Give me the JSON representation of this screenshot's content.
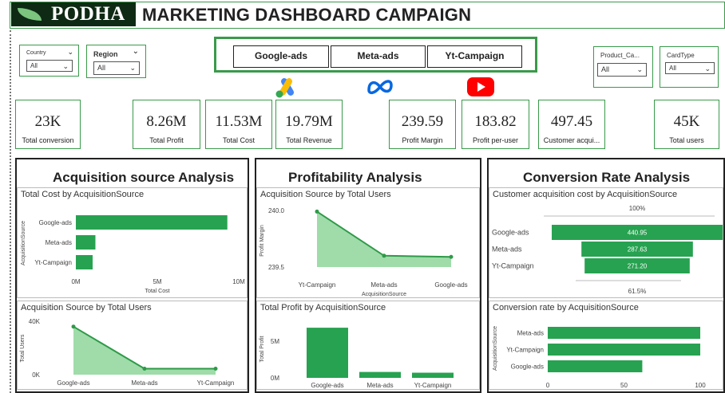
{
  "header": {
    "logo_text": "PODHA",
    "title": "MARKETING DASHBOARD CAMPAIGN"
  },
  "slicers": {
    "country": {
      "label": "Country",
      "value": "All"
    },
    "region": {
      "label": "Region",
      "value": "All"
    },
    "product_category": {
      "label": "Product_Ca...",
      "value": "All"
    },
    "card_type": {
      "label": "CardType",
      "value": "All"
    }
  },
  "source_buttons": [
    "Google-ads",
    "Meta-ads",
    "Yt-Campaign"
  ],
  "source_icons": [
    "google-ads-icon",
    "meta-icon",
    "youtube-icon"
  ],
  "kpis": [
    {
      "value": "23K",
      "label": "Total conversion"
    },
    {
      "value": "8.26M",
      "label": "Total Profit"
    },
    {
      "value": "11.53M",
      "label": "Total Cost"
    },
    {
      "value": "19.79M",
      "label": "Total Revenue"
    },
    {
      "value": "239.59",
      "label": "Profit Margin"
    },
    {
      "value": "183.82",
      "label": "Profit per-user"
    },
    {
      "value": "497.45",
      "label": "Customer acqui..."
    },
    {
      "value": "45K",
      "label": "Total users"
    }
  ],
  "panels": {
    "acquisition": "Acquisition source Analysis",
    "profitability": "Profitability Analysis",
    "conversion": "Conversion Rate Analysis"
  },
  "colors": {
    "accent": "#3a9a4a",
    "bar": "#27a250",
    "area_fill": "#9fdcaa",
    "area_line": "#2f9a48"
  },
  "chart_data": [
    {
      "id": "cost_by_source",
      "type": "bar",
      "orientation": "horizontal",
      "title": "Total Cost by AcquisitionSource",
      "xlabel": "Total Cost",
      "ylabel": "AcquisitionSource",
      "categories": [
        "Google-ads",
        "Meta-ads",
        "Yt-Campaign"
      ],
      "values": [
        9300000,
        1200000,
        1030000
      ],
      "xlim": [
        0,
        10000000
      ],
      "ticks": [
        "0M",
        "5M",
        "10M"
      ]
    },
    {
      "id": "users_by_source",
      "type": "area",
      "title": "Acquisition Source by Total Users",
      "xlabel": "",
      "ylabel": "Total Users",
      "categories": [
        "Google-ads",
        "Meta-ads",
        "Yt-Campaign"
      ],
      "values": [
        36000,
        4500,
        4500
      ],
      "ylim": [
        0,
        40000
      ],
      "ticks": [
        "0K",
        "20K",
        "40K"
      ]
    },
    {
      "id": "margin_by_source",
      "type": "area",
      "title": "Acquisition Source by Total Users",
      "xlabel": "AcquisitionSource",
      "ylabel": "Profit Margin",
      "categories": [
        "Yt-Campaign",
        "Meta-ads",
        "Google-ads"
      ],
      "values": [
        239.99,
        239.6,
        239.59
      ],
      "ylim": [
        239.5,
        240.0
      ],
      "ticks": [
        "239.5",
        "240.0"
      ]
    },
    {
      "id": "profit_by_source",
      "type": "bar",
      "title": "Total Profit by AcquisitionSource",
      "xlabel": "",
      "ylabel": "Total Profit",
      "categories": [
        "Google-ads",
        "Meta-ads",
        "Yt-Campaign"
      ],
      "values": [
        6800000,
        800000,
        700000
      ],
      "ylim": [
        0,
        8000000
      ],
      "ticks": [
        "0M",
        "5M"
      ]
    },
    {
      "id": "cac_funnel",
      "type": "bar",
      "orientation": "funnel",
      "title": "Customer acquisition cost by AcquisitionSource",
      "categories": [
        "Google-ads",
        "Meta-ads",
        "Yt-Campaign"
      ],
      "values": [
        440.95,
        287.63,
        271.2
      ],
      "labels": [
        "440.95",
        "287.63",
        "271.20"
      ],
      "top_label": "100%",
      "bottom_label": "61.5%"
    },
    {
      "id": "conversion_rate",
      "type": "bar",
      "orientation": "horizontal",
      "title": "Conversion rate by AcquisitionSource",
      "ylabel": "AcquisitionSource",
      "categories": [
        "Meta-ads",
        "Yt-Campaign",
        "Google-ads"
      ],
      "values": [
        100,
        100,
        62
      ],
      "xlim": [
        0,
        100
      ],
      "ticks": [
        "0",
        "50",
        "100"
      ]
    }
  ]
}
